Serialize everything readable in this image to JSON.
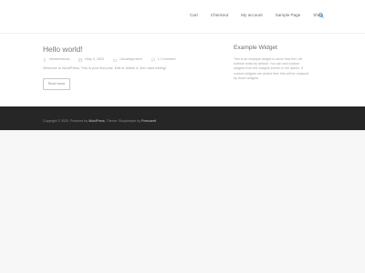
{
  "nav": {
    "items": [
      {
        "label": "Cart"
      },
      {
        "label": "Checkout"
      },
      {
        "label": "My account"
      },
      {
        "label": "Sample Page"
      },
      {
        "label": "Shop"
      }
    ],
    "search_icon": "search-icon"
  },
  "post": {
    "title": "Hello world!",
    "author": "elkofreelancs",
    "date": "May 4, 2020",
    "category": "Uncategorized",
    "comments": "1 Comment",
    "excerpt": "Welcome to WordPress. This is your first post. Edit or delete it, then start writing!",
    "read_more": "Read more"
  },
  "widget": {
    "title": "Example Widget",
    "lines": [
      "This is an example widget to show how the Left",
      "sidebar looks by default. You can add custom",
      "widgets from the widgets screen in the admin. If",
      "custom widgets are added then this will be replaced",
      "by those widgets."
    ]
  },
  "footer": {
    "copyright": "Copyright © 2020.",
    "powered_by": "Powered by",
    "wordpress": "WordPress",
    "theme_text": ". Theme: Shopkeeper by",
    "theme_author": "Freecaretl"
  },
  "colors": {
    "footer_bg": "#262626",
    "accent": "#3a8fd6"
  }
}
